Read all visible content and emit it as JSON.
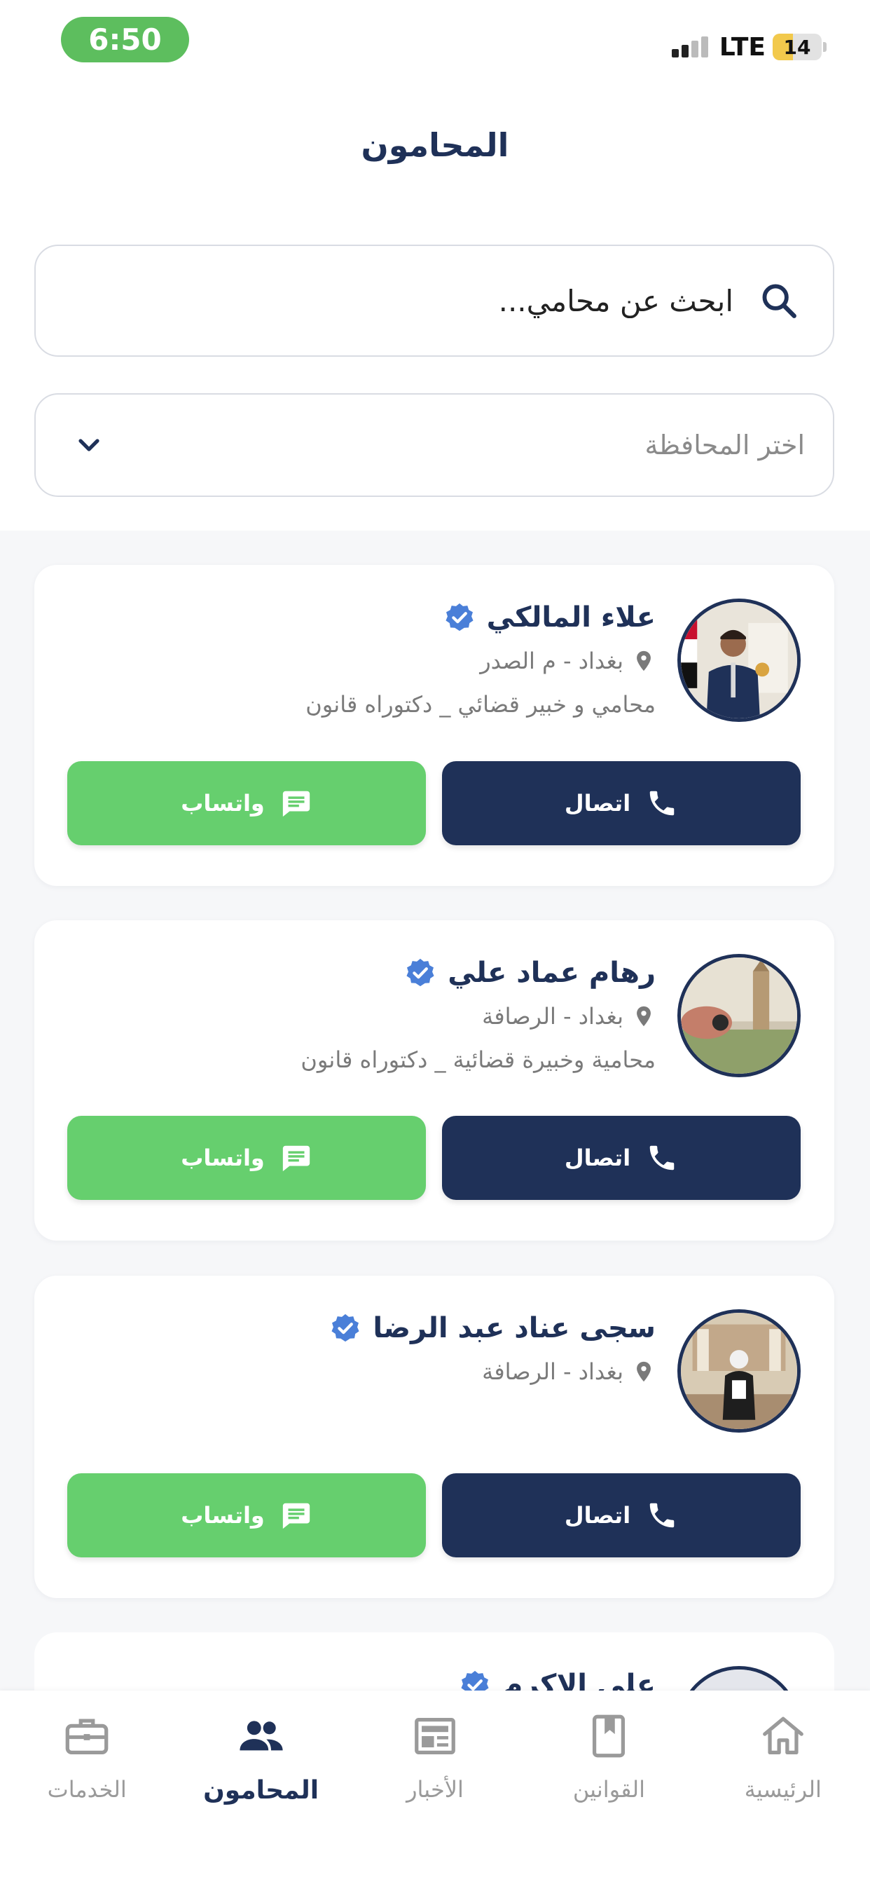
{
  "status_bar": {
    "time": "6:50",
    "network": "LTE",
    "battery": "14",
    "battery_level_percent": 14
  },
  "header": {
    "title": "المحامون"
  },
  "search": {
    "placeholder": "ابحث عن محامي..."
  },
  "province_select": {
    "placeholder": "اختر المحافظة"
  },
  "lawyers": [
    {
      "name": "علاء المالكي",
      "location": "بغداد - م الصدر",
      "description": "محامي و خبير قضائي _ دكتوراه قانون",
      "call_label": "اتصال",
      "whatsapp_label": "واتساب"
    },
    {
      "name": "رهام عماد علي",
      "location": "بغداد - الرصافة",
      "description": "محامية وخبيرة قضائية _ دكتوراه قانون",
      "call_label": "اتصال",
      "whatsapp_label": "واتساب"
    },
    {
      "name": "سجى عناد عبد الرضا",
      "location": "بغداد - الرصافة",
      "description": "",
      "call_label": "اتصال",
      "whatsapp_label": "واتساب"
    },
    {
      "name": "علي الاكرم",
      "location": "",
      "description": "",
      "call_label": "",
      "whatsapp_label": ""
    }
  ],
  "colors": {
    "primary": "#1F3158",
    "whatsapp": "#66CF6E",
    "verified": "#4A7FD8",
    "status_time_bg": "#5DBE5E"
  },
  "bottom_nav": [
    {
      "label": "الرئيسية",
      "icon": "home-icon",
      "active": false
    },
    {
      "label": "القوانين",
      "icon": "book-icon",
      "active": false
    },
    {
      "label": "الأخبار",
      "icon": "newspaper-icon",
      "active": false
    },
    {
      "label": "المحامون",
      "icon": "people-icon",
      "active": true
    },
    {
      "label": "الخدمات",
      "icon": "briefcase-icon",
      "active": false
    }
  ]
}
